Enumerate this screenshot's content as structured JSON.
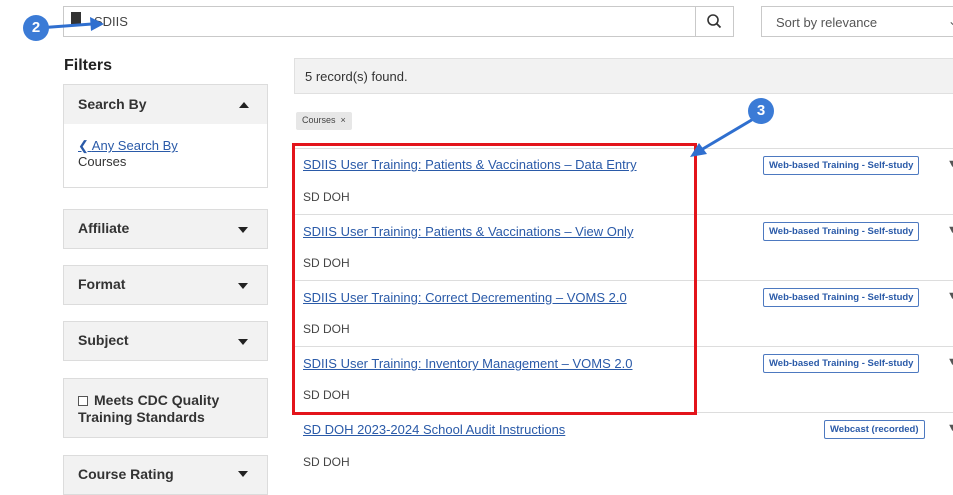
{
  "search": {
    "query": "SDIIS"
  },
  "sort": {
    "selected": "Sort by relevance"
  },
  "sidebar": {
    "title": "Filters",
    "search_by": {
      "label": "Search By",
      "link": "Any Search By",
      "value": "Courses"
    },
    "panels": [
      "Affiliate",
      "Format",
      "Subject"
    ],
    "cdc_checkbox_label_line1": "Meets CDC Quality",
    "cdc_checkbox_label_line2": "Training Standards",
    "course_rating": "Course Rating"
  },
  "results": {
    "count_text": "5 record(s) found.",
    "active_filter": "Courses",
    "items": [
      {
        "title": "SDIIS User Training: Patients & Vaccinations – Data Entry",
        "org": "SD DOH",
        "badge": "Web-based Training - Self-study"
      },
      {
        "title": "SDIIS User Training: Patients & Vaccinations – View Only",
        "org": "SD DOH",
        "badge": "Web-based Training - Self-study"
      },
      {
        "title": "SDIIS User Training: Correct Decrementing – VOMS 2.0",
        "org": "SD DOH",
        "badge": "Web-based Training - Self-study"
      },
      {
        "title": "SDIIS User Training: Inventory Management – VOMS 2.0",
        "org": "SD DOH",
        "badge": "Web-based Training - Self-study"
      },
      {
        "title": "SD DOH 2023-2024 School Audit Instructions",
        "org": "SD DOH",
        "badge": "Webcast (recorded)"
      }
    ]
  },
  "annotations": {
    "step2": "2",
    "step3": "3"
  },
  "colors": {
    "link": "#2a5aa8",
    "highlight": "#e3141b",
    "step_marker": "#3b7bd6"
  }
}
